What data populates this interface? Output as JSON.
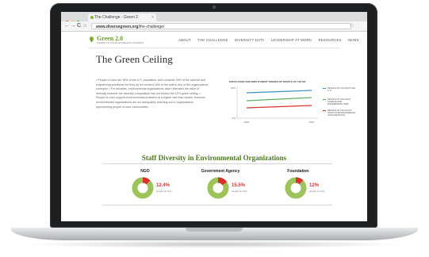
{
  "browser": {
    "tab_title": "The Challenge - Green 2",
    "tab_close": "×",
    "url_host": "www.diversegreen.org",
    "url_path": "/the-challenge/",
    "back": "←",
    "forward": "→",
    "reload": "C",
    "home": "⌂",
    "bookmark": "☆"
  },
  "site": {
    "logo_text": "Green 2.0",
    "logo_sub": "DIVERSITY IN THE ENVIRONMENTAL MOVEMENT",
    "nav": [
      "ABOUT",
      "THE CHALLENGE",
      "DIVERSITY DATA",
      "LEADERSHIP AT WORK",
      "RESOURCES",
      "NEWS"
    ]
  },
  "page": {
    "title": "The Green Ceiling",
    "body": "• People of color are 36% of the U.S. population, and comprise 29% of the science and engineering workforce but they do not exceed 16% of the staff in any of the organizations surveyed. • For decades, environmental organizations have reiterated the value of diversity however the diversity composition has not broken the 12% green ceiling. • People of color support environmental protection at a higher rate than whites. However, environmental organizations are not adequately reaching out to organizations representing people of color communities."
  },
  "chart_data": {
    "type": "line",
    "title": "POPULATION AND EMPLOYMENT TRENDS OF PEOPLE OF COLOR",
    "x": [
      "2000",
      "2010"
    ],
    "ylabel": "",
    "ytick_labels": [
      "40%",
      "0%"
    ],
    "ylim": [
      0,
      40
    ],
    "series": [
      {
        "name": "PEOPLE OF COLOR IN THE U.S.",
        "color": "#3b8fc6",
        "values": [
          32,
          35
        ]
      },
      {
        "name": "PEOPLE OF COLOR IN SCIENCE AND ENGINEERING JOBS",
        "color": "#5bb15b",
        "values": [
          22,
          26
        ]
      },
      {
        "name": "PEOPLE OF COLOR ON STAFF AT ENVIRONMENTAL ORGANIZATIONS",
        "color": "#d9322d",
        "values": [
          13,
          16
        ]
      }
    ]
  },
  "section": {
    "title": "Staff Diversity in Environmental Organizations",
    "stats": [
      {
        "label": "NGO",
        "value": "12.4%",
        "fraction": 0.124,
        "caption": "people of color"
      },
      {
        "label": "Government Agency",
        "value": "15.5%",
        "fraction": 0.155,
        "caption": "people of color"
      },
      {
        "label": "Foundation",
        "value": "12%",
        "fraction": 0.12,
        "caption": "people of color"
      }
    ]
  },
  "colors": {
    "accent_green": "#6b9e2f",
    "donut_green": "#9dc45a",
    "highlight_red": "#d9322d"
  }
}
